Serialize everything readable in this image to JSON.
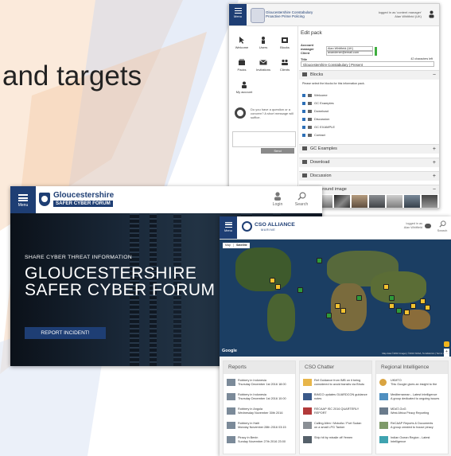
{
  "slide": {
    "title_fragment": "and targets",
    "accent_colors": [
      "#f4c9a0",
      "#b8c8e8",
      "#1e3e74"
    ]
  },
  "admin": {
    "menu_label": "Menu",
    "brand_line1": "Gloucestershire Constabulary",
    "brand_line2": "Proactive Prime Policing",
    "logged_in_line1": "logged in as 'content manager'",
    "logged_in_line2": "Alan Whitfield (UK)",
    "tiles": [
      {
        "label": "Welcome",
        "icon": "cursor-icon"
      },
      {
        "label": "Users",
        "icon": "user-icon"
      },
      {
        "label": "Blocks",
        "icon": "blocks-icon"
      },
      {
        "label": "Packs",
        "icon": "packs-icon"
      },
      {
        "label": "Invitations",
        "icon": "invitations-icon"
      },
      {
        "label": "Clients",
        "icon": "clients-icon"
      },
      {
        "label": "My account",
        "icon": "account-icon"
      }
    ],
    "help_text": "Do you have a question or a concern? A short message will suffice.",
    "send_label": "Send",
    "edit_heading": "Edit pack",
    "account_manager_label": "Account manager",
    "account_manager_value": "Alan Whitfield (UK)",
    "client_label": "Client",
    "client_value": "avandener@email.com",
    "title_label": "Title",
    "title_chars": "42 characters left",
    "title_value": "Gloucestershire Constabulary | Present",
    "blocks_heading": "Blocks",
    "blocks_hint": "Please select the blocks for this information pack.",
    "blocks": [
      "Welcome",
      "GC Examples",
      "Download",
      "Discussion",
      "GC EXAMPLE",
      "Contact"
    ],
    "sections": [
      {
        "label": "GC Examples",
        "toggle": "+"
      },
      {
        "label": "Download",
        "toggle": "+"
      },
      {
        "label": "Discussion",
        "toggle": "+"
      },
      {
        "label": "Background image",
        "toggle": "−"
      }
    ],
    "blocks_toggle": "−"
  },
  "gloucs": {
    "menu_label": "Menu",
    "logo_line1": "Gloucestershire",
    "logo_line2": "SAFER CYBER FORUM",
    "login_label": "Login",
    "search_label": "Search",
    "small_heading": "SHARE CYBER THREAT INFORMATION",
    "big_heading": "GLOUCESTERSHIRE SAFER CYBER FORUM",
    "report_button": "REPORT INCIDENT!"
  },
  "cso": {
    "menu_label": "Menu",
    "brand_line1": "CSO ALLIANCE",
    "brand_line2": "MARINE",
    "logged_in_line1": "logged in as",
    "logged_in_line2": "Alan Whitfield",
    "search_label": "Search",
    "map_tabs": [
      "Map",
      "Satellite"
    ],
    "google_label": "Google",
    "map_credit": "Map data ©2016 Imagery ©2016 NASA, TerraMetrics | Terms of Use",
    "columns": [
      {
        "heading": "Reports",
        "items": [
          {
            "line1": "Robbery in Indonesia",
            "line2": "Thursday December 1st 2016 18:00"
          },
          {
            "line1": "Robbery in Indonesia",
            "line2": "Thursday December 1st 2016 10:00"
          },
          {
            "line1": "Robbery in Angola",
            "line2": "Wednesday November 30th 2016"
          },
          {
            "line1": "Robbery in Haiti",
            "line2": "Monday November 28th 2016 03:15"
          },
          {
            "line1": "Piracy in Benin",
            "line2": "Sunday November 27th 2016 23:00"
          }
        ]
      },
      {
        "heading": "CSO Chatter",
        "items": [
          {
            "line1": "Ref Guidance from IMB on it being",
            "line2": "considered to avoid transits via Bhutu"
          },
          {
            "line1": "BIMCO updates GUARDCON guidance",
            "line2": "notes"
          },
          {
            "line1": "RECAAP ISC 2016 QUARTERLY",
            "line2": "REPORT"
          },
          {
            "line1": "Calling Allen / Mokolla / Port Sudan",
            "line2": "on a small LPG Tanker"
          },
          {
            "line1": "Ship hit by missile off Yemen",
            "line2": ""
          }
        ]
      },
      {
        "heading": "Regional Intelligence",
        "items": [
          {
            "line1": "UKMTO",
            "line2": "This Google gives an insight to the"
          },
          {
            "line1": "Mediterranean - Latest Intelligence",
            "line2": "A group dedicated to ongoing issues"
          },
          {
            "line1": "MDAT-GoG",
            "line2": "West Africa Piracy Reporting"
          },
          {
            "line1": "ReCAAP Reports & Documents",
            "line2": "A group created to house piracy"
          },
          {
            "line1": "Indian Ocean Region - Latest",
            "line2": "Intelligence"
          }
        ]
      }
    ]
  }
}
